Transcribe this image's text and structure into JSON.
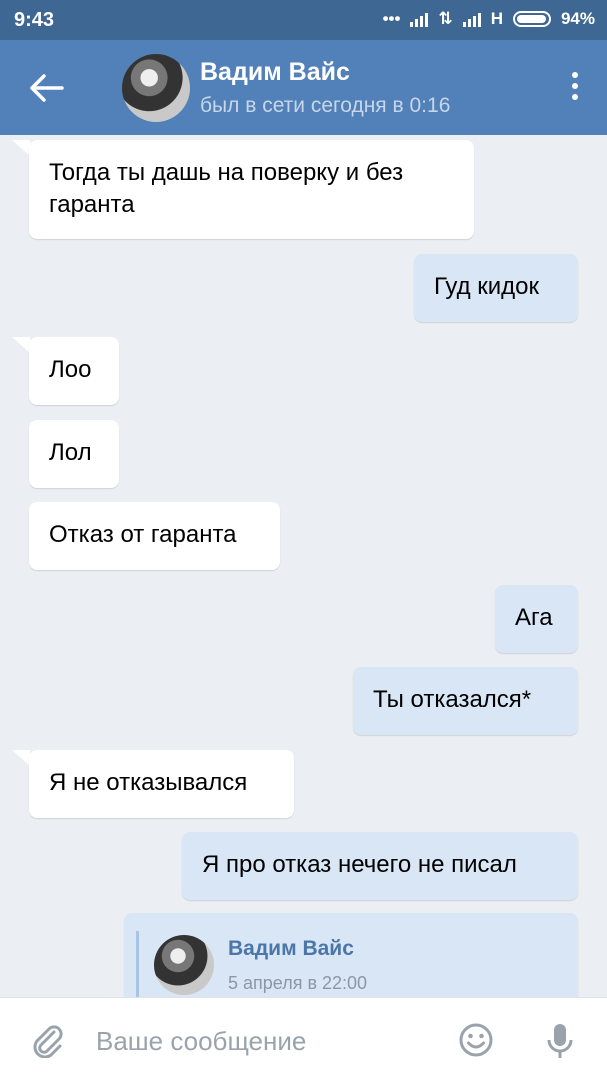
{
  "status_bar": {
    "time": "9:43",
    "network": "H",
    "battery": "94%"
  },
  "header": {
    "contact_name": "Вадим Вайс",
    "contact_status": "был в сети сегодня в 0:16"
  },
  "messages": [
    {
      "dir": "in",
      "text": "Тогда ты дашь на поверку и без гаранта"
    },
    {
      "dir": "out",
      "text": "Гуд кидок"
    },
    {
      "dir": "in",
      "text": "Лоо"
    },
    {
      "dir": "in",
      "text": "Лол"
    },
    {
      "dir": "in",
      "text": "Отказ от гаранта"
    },
    {
      "dir": "out",
      "text": "Ага"
    },
    {
      "dir": "out",
      "text": "Ты отказался*"
    },
    {
      "dir": "in",
      "text": "Я не отказывался"
    },
    {
      "dir": "out",
      "text": "Я про отказ нечего не писал"
    }
  ],
  "forwarded": {
    "author": "Вадим Вайс",
    "date": "5 апреля в 22:00"
  },
  "composer": {
    "placeholder": "Ваше сообщение"
  },
  "icons": {
    "back": "arrow-left-icon",
    "menu": "more-vertical-icon",
    "attach": "paperclip-icon",
    "emoji": "smile-icon",
    "mic": "microphone-icon"
  },
  "colors": {
    "header": "#5181b8",
    "status_bar": "#3f6794",
    "outgoing_bubble": "#d9e6f6",
    "incoming_bubble": "#ffffff",
    "background": "#ebeef2"
  }
}
